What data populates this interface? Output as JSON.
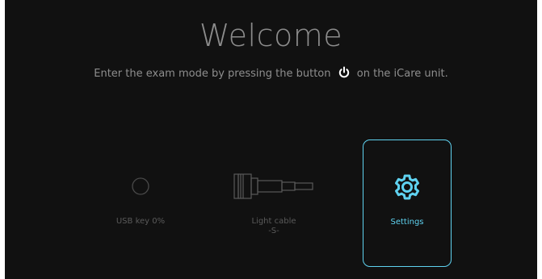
{
  "welcome": {
    "title": "Welcome",
    "instruction_before": "Enter the exam mode by pressing the button",
    "instruction_after": "on the iCare unit.",
    "instruction_icon": "power-icon"
  },
  "tiles": {
    "usb": {
      "label": "USB key 0%",
      "icon": "circle-icon",
      "progress_percent": 0
    },
    "cable": {
      "label_line1": "Light cable",
      "label_line2": "-S-",
      "icon": "light-cable-icon"
    },
    "settings": {
      "label": "Settings",
      "icon": "gear-icon",
      "selected": true
    }
  },
  "colors": {
    "background": "#111111",
    "text_muted": "#8c8c8c",
    "text_dim": "#5a5a5a",
    "accent": "#5fd2f0"
  }
}
